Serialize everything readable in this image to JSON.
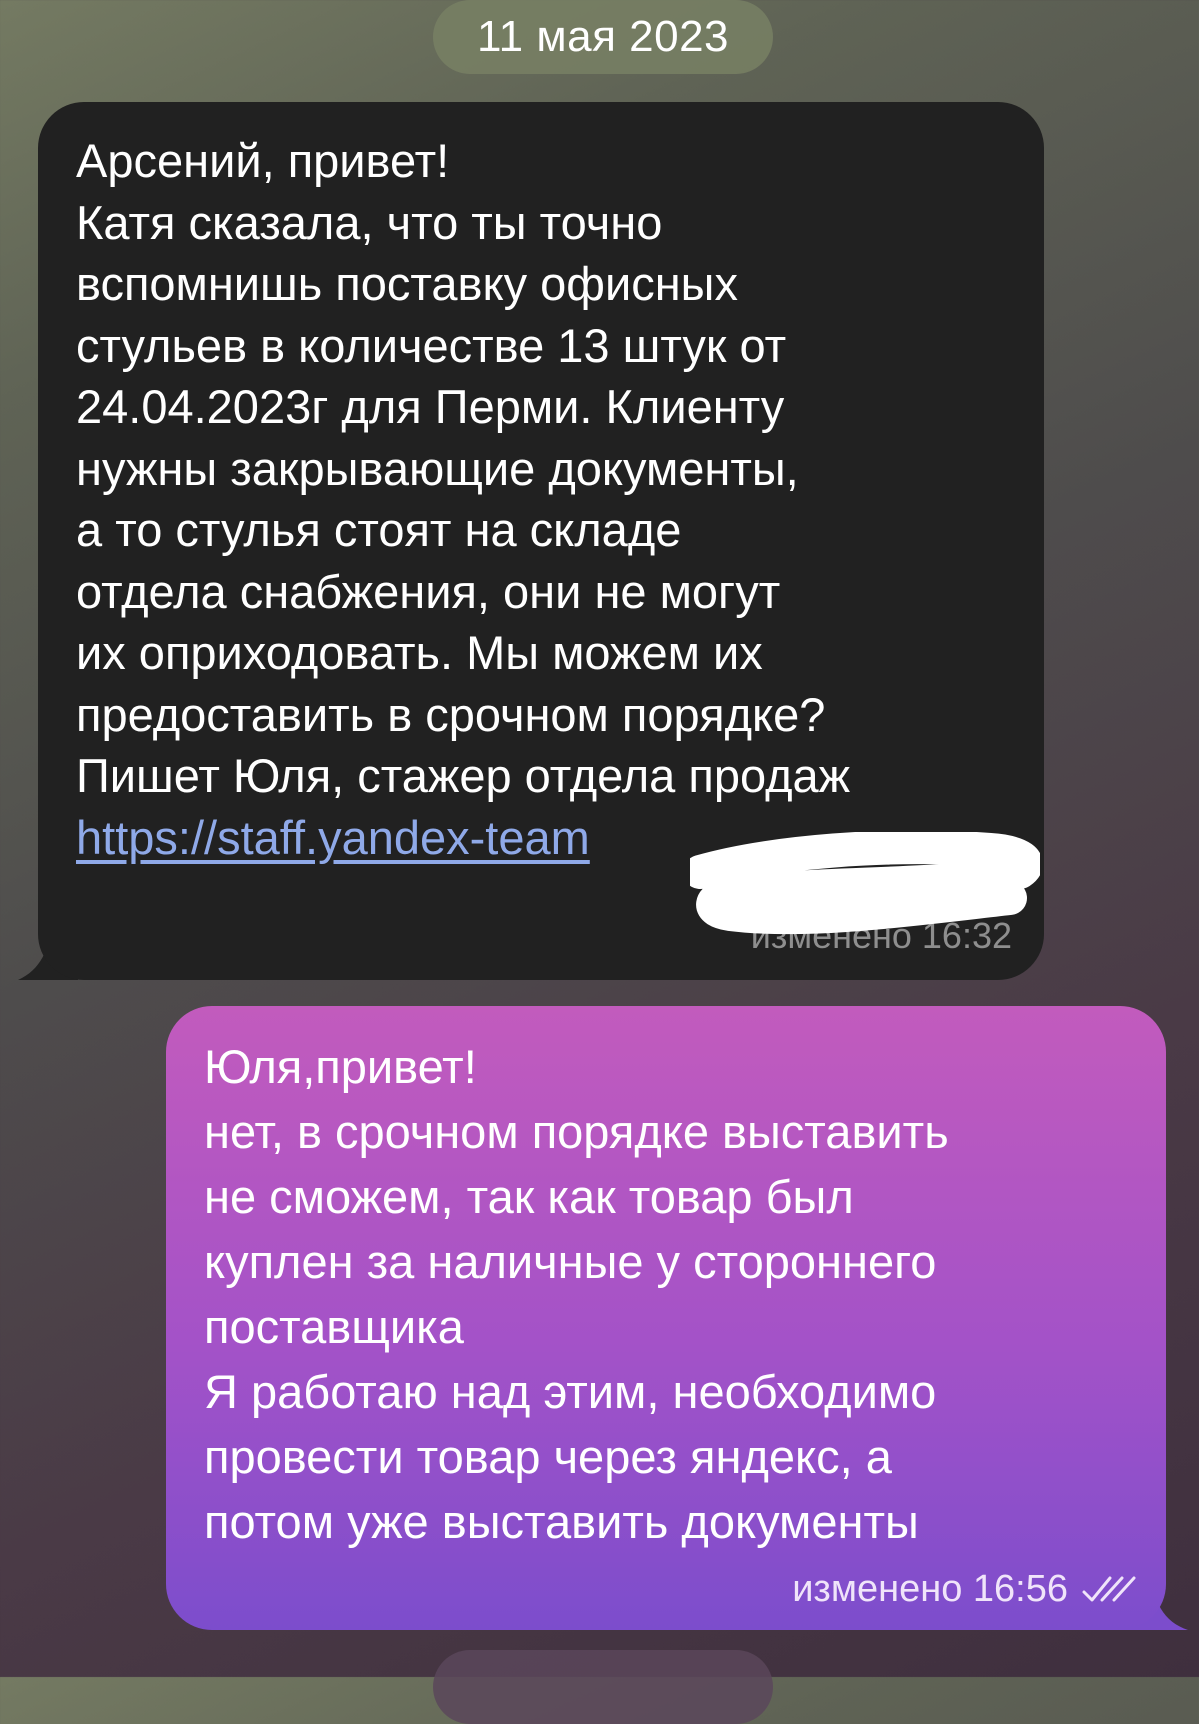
{
  "date_separator": "11 мая 2023",
  "incoming_message": {
    "lines": [
      "Арсений, привет!",
      "Катя сказала, что ты точно",
      "вспомнишь поставку офисных",
      "стульев в количестве 13 штук от",
      "24.04.2023г для Перми. Клиенту",
      "нужны закрывающие документы,",
      "а то стулья стоят на складе",
      "отдела снабжения, они не могут",
      "их оприходовать. Мы можем их",
      "предоставить в срочном порядке?",
      "Пишет Юля, стажер отдела продаж"
    ],
    "link": "https://staff.yandex-team",
    "meta": "изменено 16:32"
  },
  "outgoing_message": {
    "lines": [
      "Юля,привет!",
      "нет, в срочном порядке выставить",
      "не сможем, так как товар был",
      "куплен за наличные у стороннего",
      "поставщика",
      "Я работаю над этим, необходимо",
      "провести товар через яндекс, а",
      "потом уже выставить документы"
    ],
    "meta": "изменено 16:56",
    "status_icon": "double-check-icon"
  },
  "colors": {
    "incoming_bubble": "#212121",
    "outgoing_bubble_top": "#c25bbd",
    "outgoing_bubble_bottom": "#7c4dcc",
    "link": "#8fa9e8"
  }
}
